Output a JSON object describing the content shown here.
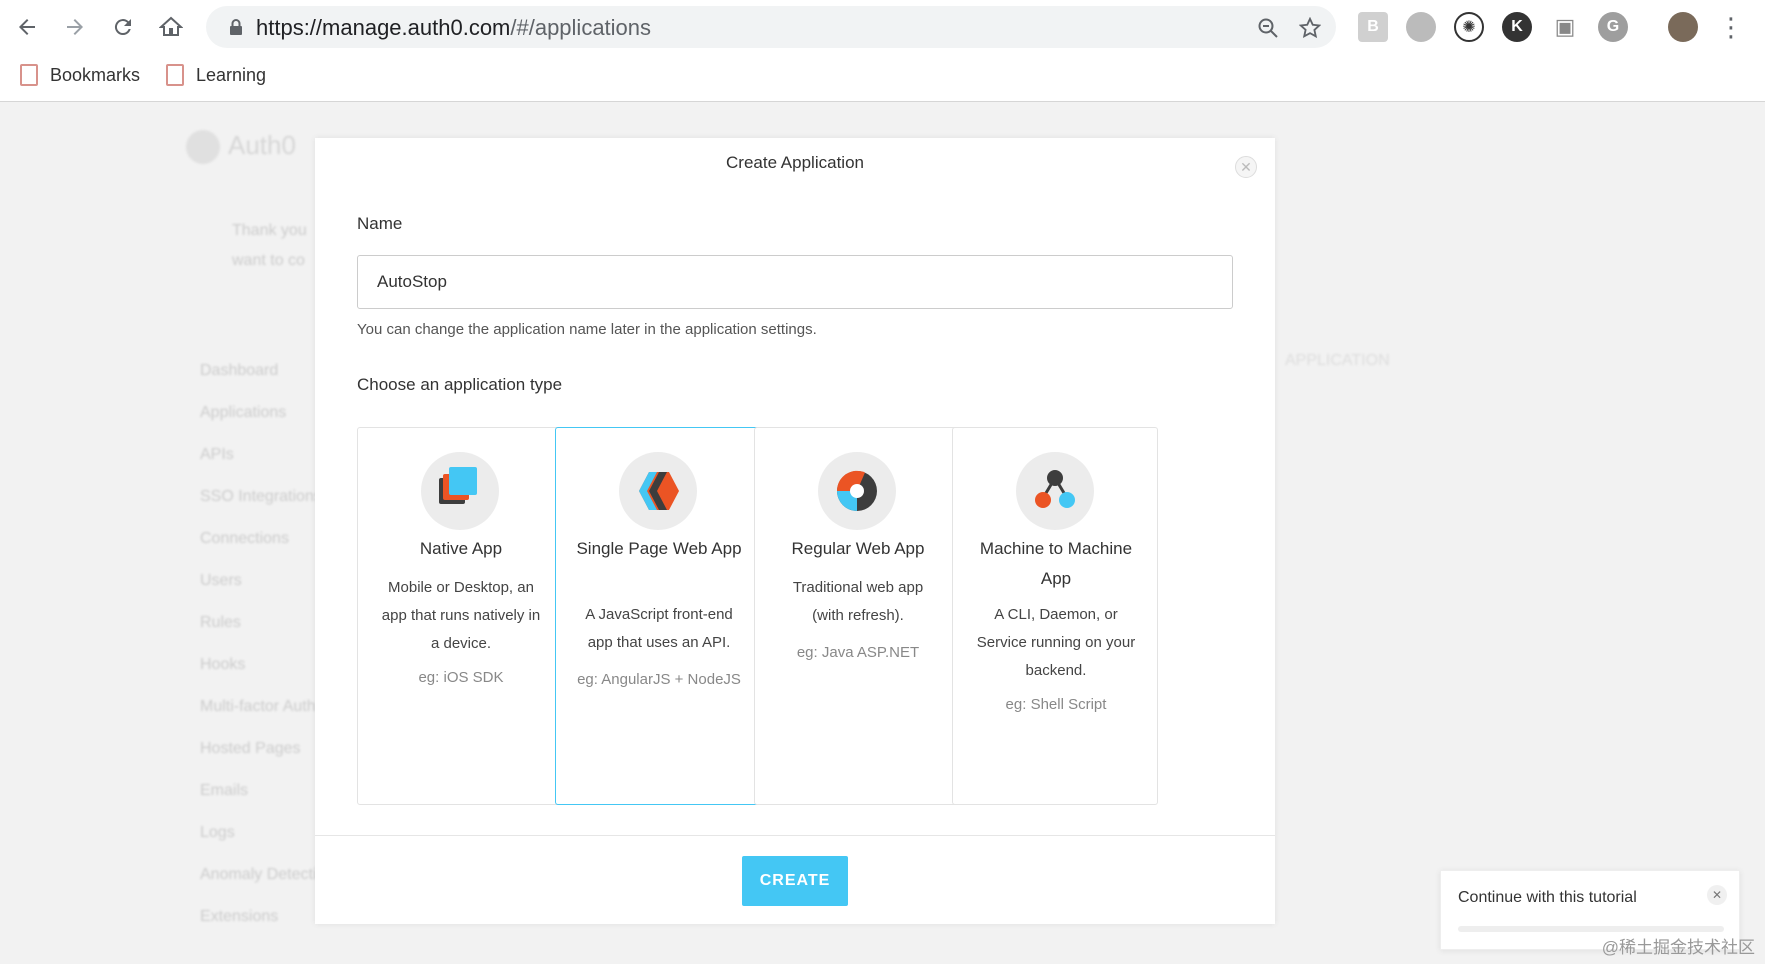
{
  "browser": {
    "url_host": "https://manage.auth0.com",
    "url_path": "/#/applications",
    "bookmarks": [
      "Bookmarks",
      "Learning"
    ]
  },
  "background": {
    "logo": "Auth0",
    "sidebar": [
      "Dashboard",
      "Applications",
      "APIs",
      "SSO Integrations",
      "Connections",
      "Users",
      "Rules",
      "Hooks",
      "Multi-factor Auth",
      "Hosted Pages",
      "Emails",
      "Logs",
      "Anomaly Detection",
      "Extensions"
    ],
    "banner_line1": "Thank you",
    "banner_line2": "want to co",
    "create_app_btn": "APPLICATION"
  },
  "modal": {
    "title": "Create Application",
    "name_label": "Name",
    "name_value": "AutoStop",
    "name_help": "You can change the application name later in the application settings.",
    "type_label": "Choose an application type",
    "create_label": "CREATE",
    "selected": "spa",
    "types": [
      {
        "name": "Native App",
        "desc": "Mobile or Desktop, an app that runs natively in a device.",
        "eg": "eg: iOS SDK"
      },
      {
        "name": "Single Page Web App",
        "desc": "A JavaScript front-end app that uses an API.",
        "eg": "eg: AngularJS + NodeJS"
      },
      {
        "name": "Regular Web App",
        "desc": "Traditional web app (with refresh).",
        "eg": "eg: Java ASP.NET"
      },
      {
        "name": "Machine to Machine App",
        "desc": "A CLI, Daemon, or Service running on your backend.",
        "eg": "eg: Shell Script"
      }
    ]
  },
  "toast": {
    "text": "Continue with this tutorial"
  },
  "watermark": "@稀土掘金技术社区",
  "colors": {
    "accent": "#44c7f4",
    "orange": "#eb5424",
    "dark": "#3d3d3d"
  }
}
